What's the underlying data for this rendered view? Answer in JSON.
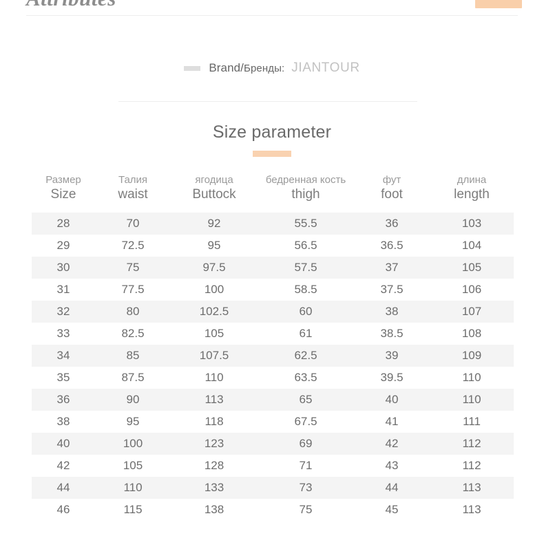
{
  "banner": {
    "title": "Attributes",
    "accent_chip_color": "#f9cfaa"
  },
  "brand": {
    "marker": "dash-marker",
    "label": "Brand/",
    "label_cyrillic": "Бренды:",
    "value": "JIANTOUR"
  },
  "section": {
    "title": "Size parameter",
    "underline_color": "#f9d2b0"
  },
  "chart_data": {
    "type": "table",
    "title": "Size parameter",
    "columns": [
      {
        "ru": "Размер",
        "en": "Size"
      },
      {
        "ru": "Талия",
        "en": "waist"
      },
      {
        "ru": "ягодица",
        "en": "Buttock"
      },
      {
        "ru": "бедренная кость",
        "en": "thigh"
      },
      {
        "ru": "фут",
        "en": "foot"
      },
      {
        "ru": "длина",
        "en": "length"
      }
    ],
    "rows": [
      [
        "28",
        "70",
        "92",
        "55.5",
        "36",
        "103"
      ],
      [
        "29",
        "72.5",
        "95",
        "56.5",
        "36.5",
        "104"
      ],
      [
        "30",
        "75",
        "97.5",
        "57.5",
        "37",
        "105"
      ],
      [
        "31",
        "77.5",
        "100",
        "58.5",
        "37.5",
        "106"
      ],
      [
        "32",
        "80",
        "102.5",
        "60",
        "38",
        "107"
      ],
      [
        "33",
        "82.5",
        "105",
        "61",
        "38.5",
        "108"
      ],
      [
        "34",
        "85",
        "107.5",
        "62.5",
        "39",
        "109"
      ],
      [
        "35",
        "87.5",
        "110",
        "63.5",
        "39.5",
        "110"
      ],
      [
        "36",
        "90",
        "113",
        "65",
        "40",
        "110"
      ],
      [
        "38",
        "95",
        "118",
        "67.5",
        "41",
        "111"
      ],
      [
        "40",
        "100",
        "123",
        "69",
        "42",
        "112"
      ],
      [
        "42",
        "105",
        "128",
        "71",
        "43",
        "112"
      ],
      [
        "44",
        "110",
        "133",
        "73",
        "44",
        "113"
      ],
      [
        "46",
        "115",
        "138",
        "75",
        "45",
        "113"
      ]
    ]
  }
}
